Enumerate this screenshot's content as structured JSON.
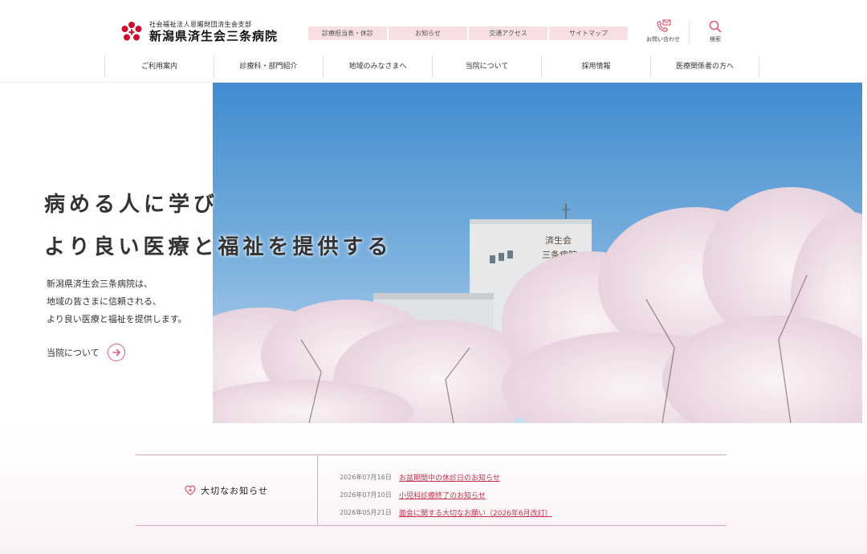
{
  "header": {
    "logo_sub": "社会福祉法人恩賜財団済生会支部",
    "logo_main": "新潟県済生会三条病院",
    "utility_links": [
      "診療担当表・休診",
      "お知らせ",
      "交通アクセス",
      "サイトマップ"
    ],
    "contact_label": "お問い合わせ",
    "search_label": "検索",
    "accent_color": "#d9607a"
  },
  "gnav": [
    "ご利用案内",
    "診療科・部門紹介",
    "地域のみなさまへ",
    "当院について",
    "採用情報",
    "医療関係者の方へ"
  ],
  "hero": {
    "headline_1": "病める人に学び",
    "headline_2": "より良い医療と福祉を提供する",
    "intro_1": "新潟県済生会三条病院は、",
    "intro_2": "地域の皆さまに信頼される、",
    "intro_3": "より良い医療と福祉を提供します。",
    "about_label": "当院について",
    "building_sign_1": "済生会",
    "building_sign_2": "三条病院"
  },
  "notices": {
    "heading": "大切なお知らせ",
    "items": [
      {
        "date": "2026年07月16日",
        "title": "お盆期間中の休診日のお知らせ"
      },
      {
        "date": "2026年07月10日",
        "title": "小児科診療終了のお知らせ"
      },
      {
        "date": "2026年05月21日",
        "title": "面会に関する大切なお願い（2026年6月改訂）"
      }
    ]
  }
}
